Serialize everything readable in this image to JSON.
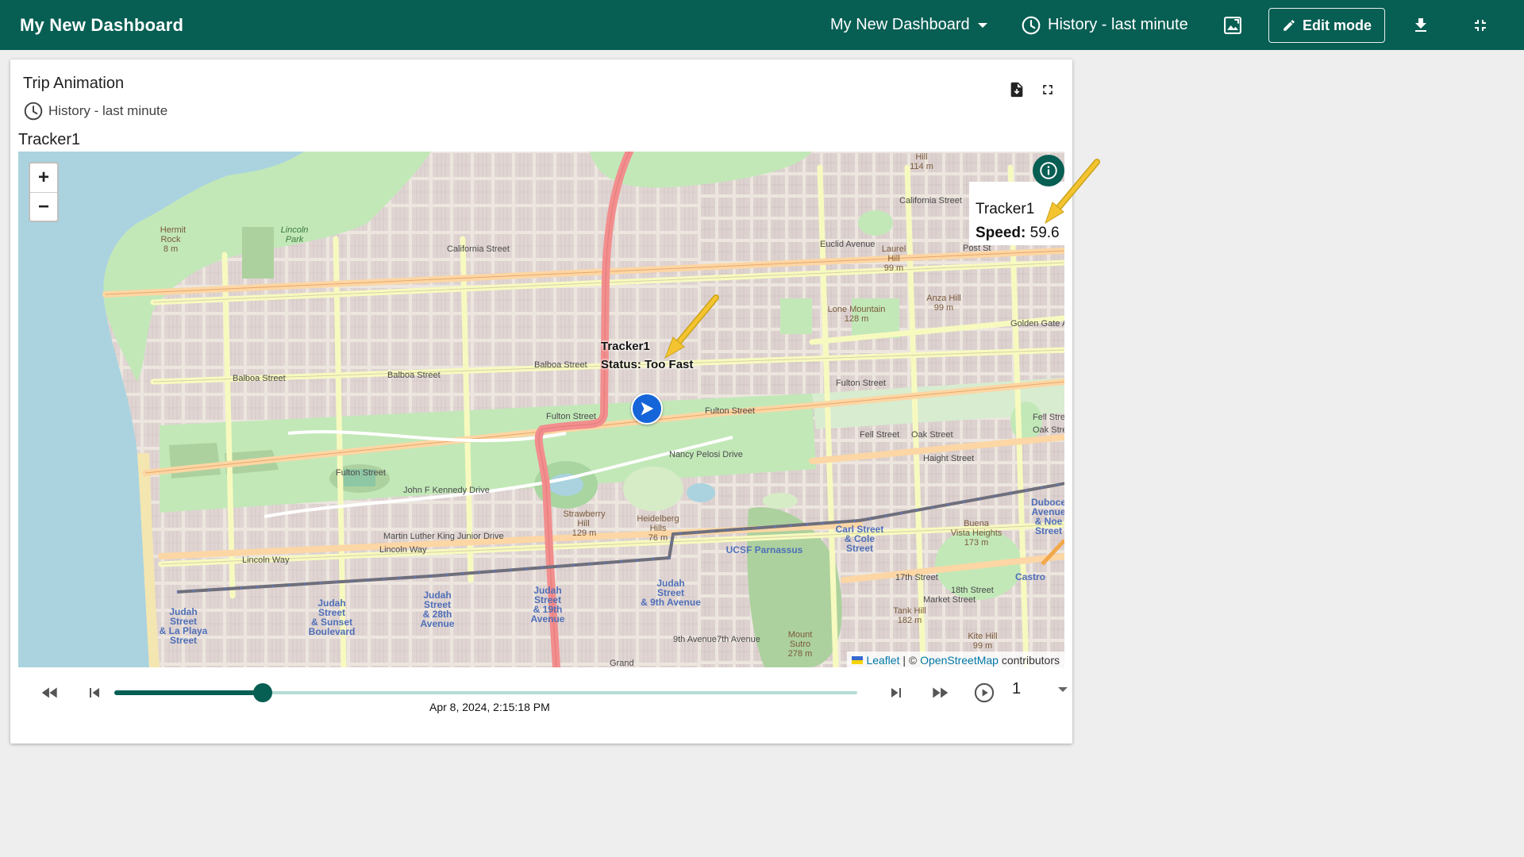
{
  "app": {
    "title": "My New Dashboard",
    "dashboard_selector": "My New Dashboard",
    "time_window": "History - last minute",
    "edit_mode_label": "Edit mode"
  },
  "widget": {
    "title": "Trip Animation",
    "time_window": "History - last minute",
    "entity_label": "Tracker1"
  },
  "map": {
    "zoom_in": "+",
    "zoom_out": "−",
    "marker_label": {
      "name": "Tracker1",
      "status": "Status: Too Fast"
    },
    "tooltip": {
      "name": "Tracker1",
      "speed_key": "Speed:",
      "speed_value": "59.6"
    },
    "attribution": {
      "leaflet": "Leaflet",
      "separator": "| ©",
      "osm": "OpenStreetMap",
      "suffix": "contributors"
    },
    "place_labels": [
      "California Street",
      "Balboa Street",
      "Fulton Street",
      "John F Kennedy Drive",
      "Lincoln Way",
      "Nancy Pelosi Drive",
      "Haight Street",
      "Oak Street",
      "Fell Street",
      "Euclid Avenue",
      "Golden Gate Ave",
      "Lincoln Park",
      "Hermit Rock",
      "8 m",
      "Strawberry Hill",
      "129 m",
      "Heidelberg Hills",
      "76 m",
      "Lone Mountain",
      "128 m",
      "Anza Hill",
      "99 m",
      "Laurel Hill",
      "UCSF Parnassus",
      "Carl Street & Cole Street",
      "Judah Street & La Playa Street",
      "Judah Street & Sunset Boulevard",
      "Judah Street & 28th Avenue",
      "Judah Street & 19th Avenue",
      "Judah Street & 9th Avenue",
      "Buena Vista Heights",
      "173 m",
      "17th Street",
      "18th Street",
      "Market Street",
      "Castro",
      "Tank Hill",
      "182 m",
      "Mount Sutro",
      "278 m",
      "Kite Hill",
      "114 m",
      "Martin Luther King Junior Drive",
      "7th Avenue",
      "9th Avenue",
      "Grand",
      "Duboce Avenue & Noe Street",
      "Post St",
      "Fell Stre",
      "Oak Stre"
    ]
  },
  "player": {
    "timestamp": "Apr 8, 2024, 2:15:18 PM",
    "progress": 0.2,
    "speed": "1"
  },
  "colors": {
    "brand": "#075e53",
    "marker": "#1565d8",
    "slider_rail": "#b6dcd6",
    "annotation": "#f4c430"
  },
  "icons": {
    "history": "clock-icon",
    "image_export": "image-icon",
    "download": "download-icon",
    "fullscreen_exit": "fullscreen-exit-icon",
    "pdf": "pdf-export-icon",
    "fullscreen": "fullscreen-icon",
    "info": "info-icon",
    "play": "play-circle-icon"
  }
}
